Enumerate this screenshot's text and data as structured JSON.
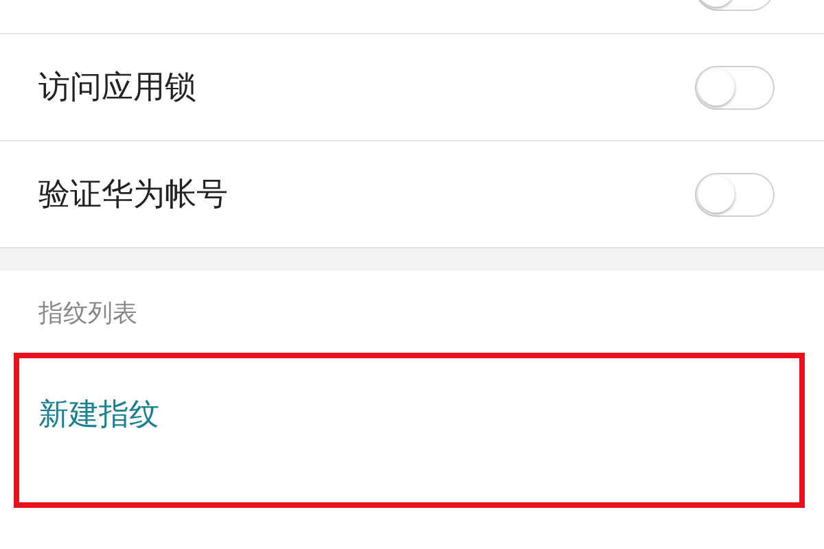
{
  "top_switch": {
    "on": false
  },
  "settings": [
    {
      "label": "访问应用锁",
      "on": false
    },
    {
      "label": "验证华为帐号",
      "on": false
    }
  ],
  "fingerprint_section": {
    "header": "指纹列表",
    "new_item": "新建指纹",
    "highlighted": true
  }
}
